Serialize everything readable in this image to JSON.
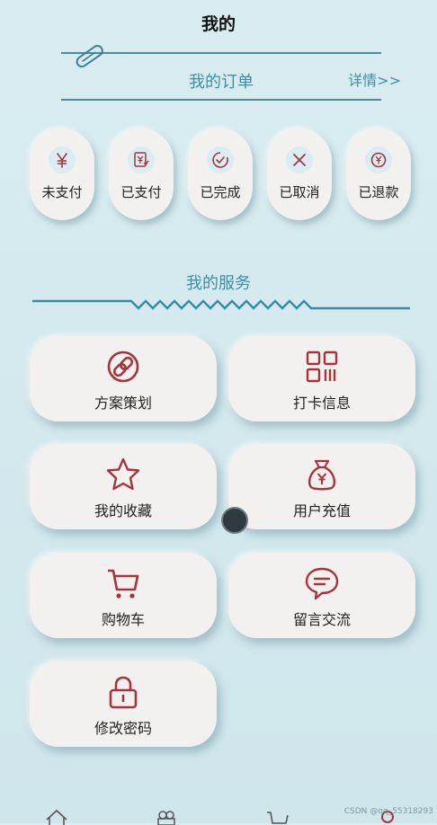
{
  "page": {
    "title": "我的"
  },
  "orders": {
    "title": "我的订单",
    "detail_link": "详情>>",
    "items": [
      {
        "label": "未支付",
        "icon": "yen-icon"
      },
      {
        "label": "已支付",
        "icon": "receipt-icon"
      },
      {
        "label": "已完成",
        "icon": "check-circle-icon"
      },
      {
        "label": "已取消",
        "icon": "close-icon"
      },
      {
        "label": "已退款",
        "icon": "refund-icon"
      }
    ]
  },
  "services": {
    "title": "我的服务",
    "items": [
      {
        "label": "方案策划",
        "icon": "link-circle-icon"
      },
      {
        "label": "打卡信息",
        "icon": "qr-code-icon"
      },
      {
        "label": "我的收藏",
        "icon": "star-icon"
      },
      {
        "label": "用户充值",
        "icon": "money-bag-icon"
      },
      {
        "label": "购物车",
        "icon": "cart-icon"
      },
      {
        "label": "留言交流",
        "icon": "chat-bubble-icon"
      },
      {
        "label": "修改密码",
        "icon": "lock-icon"
      }
    ]
  },
  "bottom_nav": {
    "items": [
      {
        "icon": "home-icon"
      },
      {
        "icon": "gift-icon"
      },
      {
        "icon": "cart-icon"
      },
      {
        "icon": "user-icon"
      }
    ]
  },
  "watermark": "CSDN @qq_55318293",
  "colors": {
    "accent": "#3d8ea8",
    "icon_red": "#a6343c",
    "card_bg": "#f3f1ef",
    "page_bg": "#d6ebf0"
  }
}
